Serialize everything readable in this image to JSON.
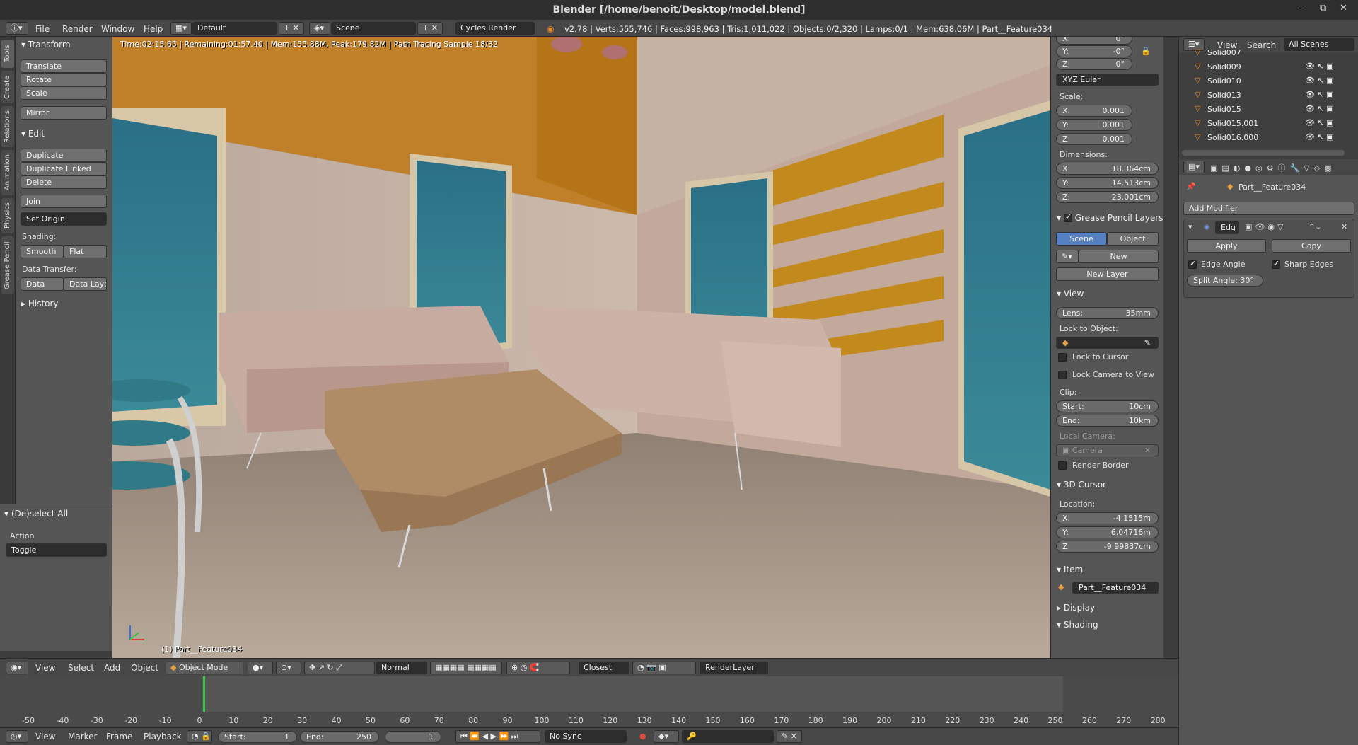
{
  "window": {
    "title": "Blender [/home/benoit/Desktop/model.blend]",
    "controls": [
      "–",
      "⧉",
      "✕"
    ]
  },
  "info_header": {
    "menus": [
      "File",
      "Render",
      "Window",
      "Help"
    ],
    "layout": "Default",
    "scene": "Scene",
    "engine": "Cycles Render",
    "stats": "v2.78 | Verts:555,746 | Faces:998,963 | Tris:1,011,022 | Objects:0/2,320 | Lamps:0/1 | Mem:638.06M | Part__Feature034"
  },
  "tabs": [
    "Tools",
    "Create",
    "Relations",
    "Animation",
    "Physics",
    "Grease Pencil"
  ],
  "toolshelf": {
    "transform": {
      "title": "Transform",
      "buttons": [
        "Translate",
        "Rotate",
        "Scale",
        "Mirror"
      ]
    },
    "edit": {
      "title": "Edit",
      "buttons": [
        "Duplicate",
        "Duplicate Linked",
        "Delete",
        "Join"
      ],
      "set_origin": "Set Origin",
      "shading_label": "Shading:",
      "smooth": "Smooth",
      "flat": "Flat",
      "data_transfer_label": "Data Transfer:",
      "data": "Data",
      "data_layout": "Data Layo"
    },
    "history": "History"
  },
  "operator": {
    "title": "(De)select All",
    "action_label": "Action",
    "action": "Toggle"
  },
  "viewport": {
    "info": "Time:02:15.65 | Remaining:01:57.40 | Mem:155.88M, Peak:179.82M | Path Tracing Sample 18/32",
    "object": "(1) Part__Feature034"
  },
  "npanel": {
    "rotation": [
      {
        "axis": "X:",
        "value": "0°"
      },
      {
        "axis": "Y:",
        "value": "-0°"
      },
      {
        "axis": "Z:",
        "value": "0°"
      }
    ],
    "rotation_mode": "XYZ Euler",
    "scale_label": "Scale:",
    "scale": [
      {
        "axis": "X:",
        "value": "0.001"
      },
      {
        "axis": "Y:",
        "value": "0.001"
      },
      {
        "axis": "Z:",
        "value": "0.001"
      }
    ],
    "dimensions_label": "Dimensions:",
    "dimensions": [
      {
        "axis": "X:",
        "value": "18.364cm"
      },
      {
        "axis": "Y:",
        "value": "14.513cm"
      },
      {
        "axis": "Z:",
        "value": "23.001cm"
      }
    ],
    "grease_pencil": {
      "title": "Grease Pencil Layers",
      "scene": "Scene",
      "object": "Object",
      "new": "New",
      "new_layer": "New Layer"
    },
    "view": {
      "title": "View",
      "lens_label": "Lens:",
      "lens": "35mm",
      "lock_to_object": "Lock to Object:",
      "lock_to_cursor": "Lock to Cursor",
      "lock_camera": "Lock Camera to View",
      "clip_label": "Clip:",
      "clip_start_label": "Start:",
      "clip_start": "10cm",
      "clip_end_label": "End:",
      "clip_end": "10km",
      "local_camera": "Local Camera:",
      "camera": "Camera",
      "render_border": "Render Border"
    },
    "cursor": {
      "title": "3D Cursor",
      "location_label": "Location:",
      "location": [
        {
          "axis": "X:",
          "value": "-4.1515m"
        },
        {
          "axis": "Y:",
          "value": "6.04716m"
        },
        {
          "axis": "Z:",
          "value": "-9.99837cm"
        }
      ]
    },
    "item": {
      "title": "Item",
      "name": "Part__Feature034"
    },
    "display": "Display",
    "shading": "Shading"
  },
  "outliner": {
    "menus": [
      "View",
      "Search"
    ],
    "filter": "All Scenes",
    "rows": [
      "Solid007",
      "Solid009",
      "Solid010",
      "Solid013",
      "Solid015",
      "Solid015.001",
      "Solid016.000"
    ]
  },
  "properties": {
    "object": "Part__Feature034",
    "add_modifier": "Add Modifier",
    "modifier_name": "Edg",
    "apply": "Apply",
    "copy": "Copy",
    "edge_angle": "Edge Angle",
    "sharp_edges": "Sharp Edges",
    "split_angle": "Split Angle: 30°"
  },
  "view3d_header": {
    "menus": [
      "View",
      "Select",
      "Add",
      "Object"
    ],
    "mode": "Object Mode",
    "orientation": "Normal",
    "snap": "Closest",
    "render_layer": "RenderLayer"
  },
  "timeline": {
    "ticks": [
      -50,
      -40,
      -30,
      -20,
      -10,
      0,
      10,
      20,
      30,
      40,
      50,
      60,
      70,
      80,
      90,
      100,
      110,
      120,
      130,
      140,
      150,
      160,
      170,
      180,
      190,
      200,
      210,
      220,
      230,
      240,
      250,
      260,
      270,
      280
    ],
    "current_frame": 1
  },
  "timeline_header": {
    "menus": [
      "View",
      "Marker",
      "Frame",
      "Playback"
    ],
    "start_label": "Start:",
    "start": "1",
    "end_label": "End:",
    "end": "250",
    "current": "1",
    "sync": "No Sync"
  },
  "colors": {
    "accent_blue": "#5680c2",
    "frame_green": "#33cc44",
    "window_bg": "#3d3d3d"
  }
}
